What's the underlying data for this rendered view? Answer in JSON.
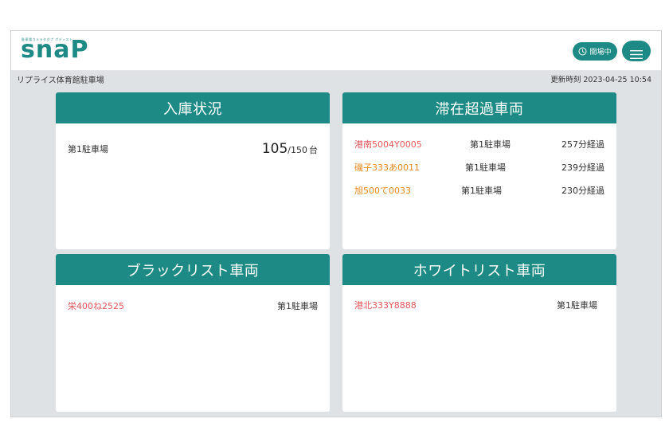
{
  "header": {
    "logo_tagline": "駐車場カメラタグプ ボディスト",
    "logo_text": "snaP",
    "status_label": "開場中",
    "menu_icon": "hamburger-icon",
    "status_icon": "clock-icon"
  },
  "subheader": {
    "lot_name": "リプライス体育館駐車場",
    "updated_label": "更新時刻",
    "updated_value": "2023-04-25 10:54"
  },
  "colors": {
    "accent": "#1d8a85",
    "background": "#dfe2e4",
    "plate_red": "#e2565b",
    "plate_orange": "#e88a1e"
  },
  "parking": {
    "title": "入庫状況",
    "rows": [
      {
        "name": "第1駐車場",
        "current": "105",
        "total": "/150",
        "unit": "台"
      }
    ]
  },
  "overstay": {
    "title": "滞在超過車両",
    "rows": [
      {
        "plate": "港南5004Y0005",
        "lot": "第1駐車場",
        "elapsed": "257分経過"
      },
      {
        "plate": "磯子333あ0011",
        "lot": "第1駐車場",
        "elapsed": "239分経過"
      },
      {
        "plate": "旭500て0033",
        "lot": "第1駐車場",
        "elapsed": "230分経過"
      }
    ]
  },
  "blacklist": {
    "title": "ブラックリスト車両",
    "rows": [
      {
        "plate": "栄400ね2525",
        "lot": "第1駐車場"
      }
    ]
  },
  "whitelist": {
    "title": "ホワイトリスト車両",
    "rows": [
      {
        "plate": "港北333Y8888",
        "lot": "第1駐車場"
      }
    ]
  }
}
